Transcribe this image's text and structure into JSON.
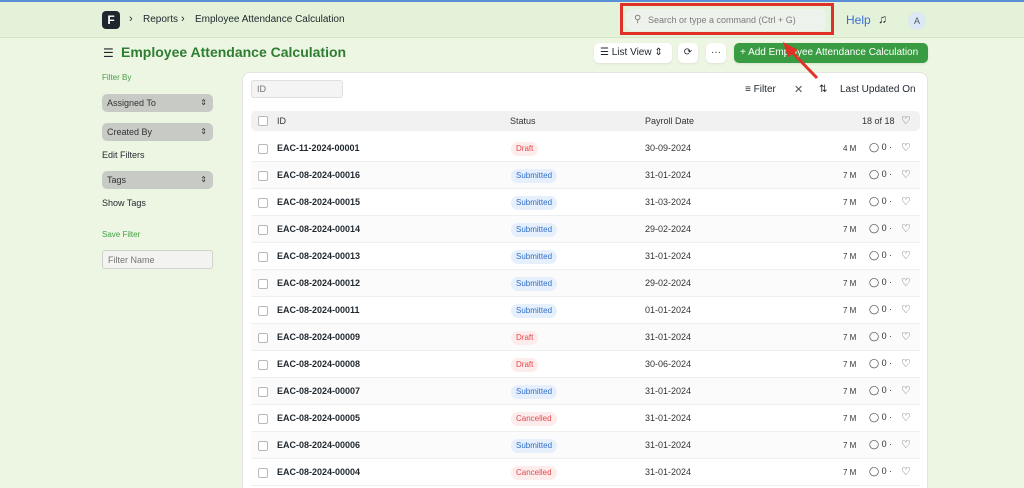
{
  "nav": {
    "logo": "F",
    "breadcrumbs": [
      "Reports",
      "Employee Attendance Calculation"
    ],
    "search_placeholder": "Search or type a command (Ctrl + G)",
    "help": "Help",
    "avatar": "A"
  },
  "header": {
    "title": "Employee Attendance Calculation",
    "list_view": "List View",
    "add_button": "+ Add Employee Attendance Calculation"
  },
  "sidebar": {
    "filter_by": "Filter By",
    "assigned_to": "Assigned To",
    "created_by": "Created By",
    "edit_filters": "Edit Filters",
    "tags": "Tags",
    "show_tags": "Show Tags",
    "save_filter": "Save Filter",
    "filter_name_placeholder": "Filter Name"
  },
  "toolbar": {
    "id_placeholder": "ID",
    "filter": "Filter",
    "sort": "Last Updated On"
  },
  "table": {
    "columns": {
      "id": "ID",
      "status": "Status",
      "payroll_date": "Payroll Date"
    },
    "count": "18 of 18",
    "rows": [
      {
        "id": "EAC-11-2024-00001",
        "status": "Draft",
        "date": "30-09-2024",
        "age": "4 M",
        "comments": "0"
      },
      {
        "id": "EAC-08-2024-00016",
        "status": "Submitted",
        "date": "31-01-2024",
        "age": "7 M",
        "comments": "0"
      },
      {
        "id": "EAC-08-2024-00015",
        "status": "Submitted",
        "date": "31-03-2024",
        "age": "7 M",
        "comments": "0"
      },
      {
        "id": "EAC-08-2024-00014",
        "status": "Submitted",
        "date": "29-02-2024",
        "age": "7 M",
        "comments": "0"
      },
      {
        "id": "EAC-08-2024-00013",
        "status": "Submitted",
        "date": "31-01-2024",
        "age": "7 M",
        "comments": "0"
      },
      {
        "id": "EAC-08-2024-00012",
        "status": "Submitted",
        "date": "29-02-2024",
        "age": "7 M",
        "comments": "0"
      },
      {
        "id": "EAC-08-2024-00011",
        "status": "Submitted",
        "date": "01-01-2024",
        "age": "7 M",
        "comments": "0"
      },
      {
        "id": "EAC-08-2024-00009",
        "status": "Draft",
        "date": "31-01-2024",
        "age": "7 M",
        "comments": "0"
      },
      {
        "id": "EAC-08-2024-00008",
        "status": "Draft",
        "date": "30-06-2024",
        "age": "7 M",
        "comments": "0"
      },
      {
        "id": "EAC-08-2024-00007",
        "status": "Submitted",
        "date": "31-01-2024",
        "age": "7 M",
        "comments": "0"
      },
      {
        "id": "EAC-08-2024-00005",
        "status": "Cancelled",
        "date": "31-01-2024",
        "age": "7 M",
        "comments": "0"
      },
      {
        "id": "EAC-08-2024-00006",
        "status": "Submitted",
        "date": "31-01-2024",
        "age": "7 M",
        "comments": "0"
      },
      {
        "id": "EAC-08-2024-00004",
        "status": "Cancelled",
        "date": "31-01-2024",
        "age": "7 M",
        "comments": "0"
      }
    ]
  }
}
